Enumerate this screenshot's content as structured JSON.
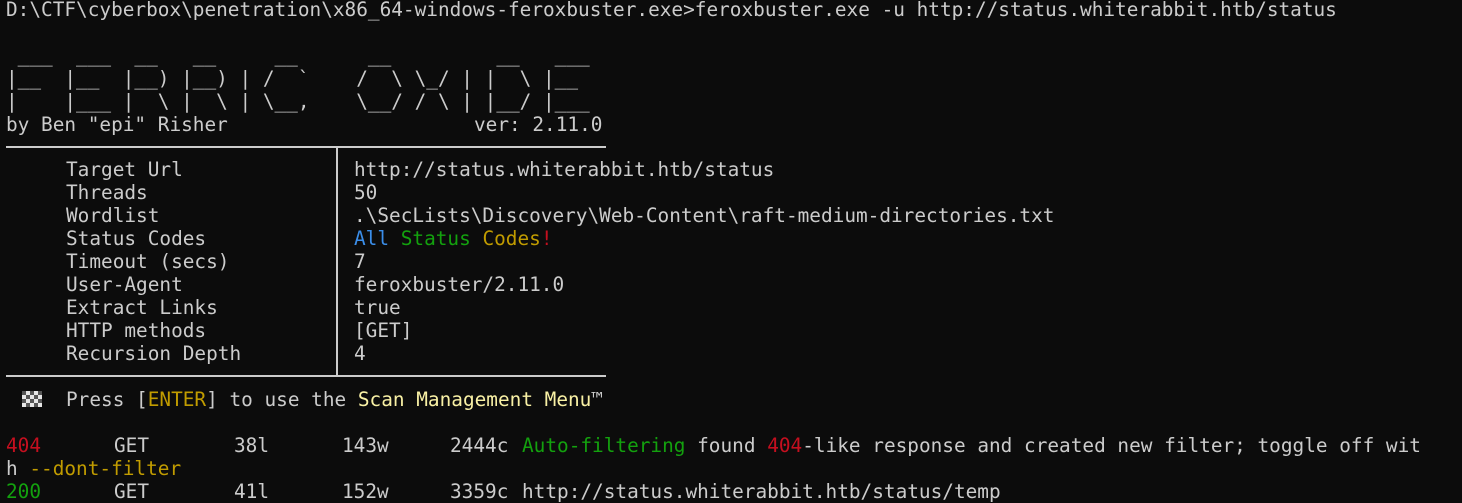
{
  "prompt": {
    "path": "D:\\CTF\\cyberbox\\penetration\\x86_64-windows-feroxbuster.exe>",
    "command": "feroxbuster.exe -u http://status.whiterabbit.htb/status"
  },
  "banner": {
    "art_lines": [
      " ___  ___  __   __     __      __         __   ___",
      "|__  |__  |__) |__) | /  `    /  \\ \\_/ | |  \\ |__",
      "|    |___ |  \\ |  \\ | \\__,    \\__/ / \\ | |__/ |___"
    ],
    "author": "by Ben \"epi\" Risher",
    "version": "ver: 2.11.0"
  },
  "config": [
    {
      "key": "Target Url",
      "value": "http://status.whiterabbit.htb/status"
    },
    {
      "key": "Threads",
      "value": "50"
    },
    {
      "key": "Wordlist",
      "value": ".\\SecLists\\Discovery\\Web-Content\\raft-medium-directories.txt"
    },
    {
      "key": "Status Codes",
      "value": ""
    },
    {
      "key": "Timeout (secs)",
      "value": "7"
    },
    {
      "key": "User-Agent",
      "value": "feroxbuster/2.11.0"
    },
    {
      "key": "Extract Links",
      "value": "true"
    },
    {
      "key": "HTTP methods",
      "value": "[GET]"
    },
    {
      "key": "Recursion Depth",
      "value": "4"
    }
  ],
  "status_codes_value": {
    "all": "All",
    "status": "Status",
    "codes": "Codes",
    "bang": "!"
  },
  "menu_hint": {
    "press": "Press [",
    "enter": "ENTER",
    "middle": "] to use the ",
    "menu": "Scan Management Menu",
    "tm": "™"
  },
  "results": [
    {
      "status": "404",
      "method": "GET",
      "lines": "38l",
      "words": "143w",
      "chars": "2444c",
      "auto": "Auto-filtering",
      "found": " found ",
      "code": "404",
      "rest": "-like response and created new filter; toggle off wit",
      "wrap_prefix": "h ",
      "wrap_flag": "--dont-filter"
    },
    {
      "status": "200",
      "method": "GET",
      "lines": "41l",
      "words": "152w",
      "chars": "3359c",
      "url": "http://status.whiterabbit.htb/status/temp"
    }
  ],
  "colors": {
    "background": "#0c0c0c",
    "foreground": "#cccccc",
    "blue": "#3b8eea",
    "green": "#13a10e",
    "yellow": "#c19c00",
    "red": "#c50f1f",
    "light_yellow": "#f9f1a5"
  }
}
